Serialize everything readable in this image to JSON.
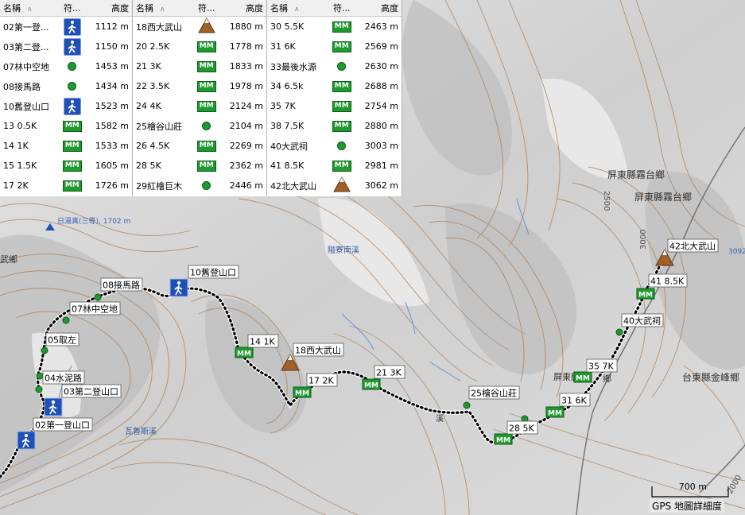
{
  "table": {
    "headers": {
      "name": "名稱",
      "symbol": "符...",
      "altitude": "高度"
    },
    "col1": [
      {
        "name": "02第一登...",
        "sym": "hiker-icon",
        "alt": "1112 m"
      },
      {
        "name": "03第二登...",
        "sym": "hiker-icon",
        "alt": "1150 m"
      },
      {
        "name": "07林中空地",
        "sym": "dot-icon",
        "alt": "1453 m"
      },
      {
        "name": "08接馬路",
        "sym": "dot-icon",
        "alt": "1434 m"
      },
      {
        "name": "10舊登山口",
        "sym": "hiker-icon",
        "alt": "1523 m"
      },
      {
        "name": "13 0.5K",
        "sym": "mm-icon",
        "alt": "1582 m"
      },
      {
        "name": "14 1K",
        "sym": "mm-icon",
        "alt": "1533 m"
      },
      {
        "name": "15 1.5K",
        "sym": "mm-icon",
        "alt": "1605 m"
      },
      {
        "name": "17 2K",
        "sym": "mm-icon",
        "alt": "1726 m"
      }
    ],
    "col2": [
      {
        "name": "18西大武山",
        "sym": "peak-icon",
        "alt": "1880 m"
      },
      {
        "name": "20 2.5K",
        "sym": "mm-icon",
        "alt": "1778 m"
      },
      {
        "name": "21 3K",
        "sym": "mm-icon",
        "alt": "1833 m"
      },
      {
        "name": "22 3.5K",
        "sym": "mm-icon",
        "alt": "1978 m"
      },
      {
        "name": "24 4K",
        "sym": "mm-icon",
        "alt": "2124 m"
      },
      {
        "name": "25檜谷山莊",
        "sym": "dot-icon",
        "alt": "2104 m"
      },
      {
        "name": "26 4.5K",
        "sym": "mm-icon",
        "alt": "2269 m"
      },
      {
        "name": "28 5K",
        "sym": "mm-icon",
        "alt": "2362 m"
      },
      {
        "name": "29紅檜巨木",
        "sym": "dot-icon",
        "alt": "2446 m"
      }
    ],
    "col3": [
      {
        "name": "30 5.5K",
        "sym": "mm-icon",
        "alt": "2463 m"
      },
      {
        "name": "31 6K",
        "sym": "mm-icon",
        "alt": "2569 m"
      },
      {
        "name": "33最後水源",
        "sym": "dot-icon",
        "alt": "2630 m"
      },
      {
        "name": "34 6.5k",
        "sym": "mm-icon",
        "alt": "2688 m"
      },
      {
        "name": "35 7K",
        "sym": "mm-icon",
        "alt": "2754 m"
      },
      {
        "name": "38 7.5K",
        "sym": "mm-icon",
        "alt": "2880 m"
      },
      {
        "name": "40大武祠",
        "sym": "dot-icon",
        "alt": "3003 m"
      },
      {
        "name": "41 8.5K",
        "sym": "mm-icon",
        "alt": "2981 m"
      },
      {
        "name": "42北大武山",
        "sym": "peak-icon",
        "alt": "3062 m"
      }
    ],
    "mm_text": "MM"
  },
  "map": {
    "place_labels": [
      "日湯真(三等), 1702 m",
      "武鄉",
      "屏東縣霧台鄉",
      "屏東縣霧台鄉",
      "台東縣金峰鄉",
      "屏東縣",
      "鄉",
      "溪"
    ],
    "contour_labels": [
      "2500",
      "3000",
      "2000",
      "3092"
    ],
    "waypoint_labels": [
      "02第一登山口",
      "03第二登山口",
      "04水泥路",
      "05取左",
      "07林中空地",
      "08接馬路",
      "10舊登山口",
      "14 1K",
      "18西大武山",
      "17 2K",
      "21 3K",
      "25檜谷山莊",
      "28 5K",
      "31 6K",
      "35 7K",
      "40大武祠",
      "41 8.5K",
      "42北大武山"
    ],
    "river_labels": [
      "隘寮南溪",
      "瓦魯斯溪"
    ]
  },
  "scale": {
    "label": "700 m"
  },
  "status": {
    "detail": "GPS 地圖詳細度"
  }
}
